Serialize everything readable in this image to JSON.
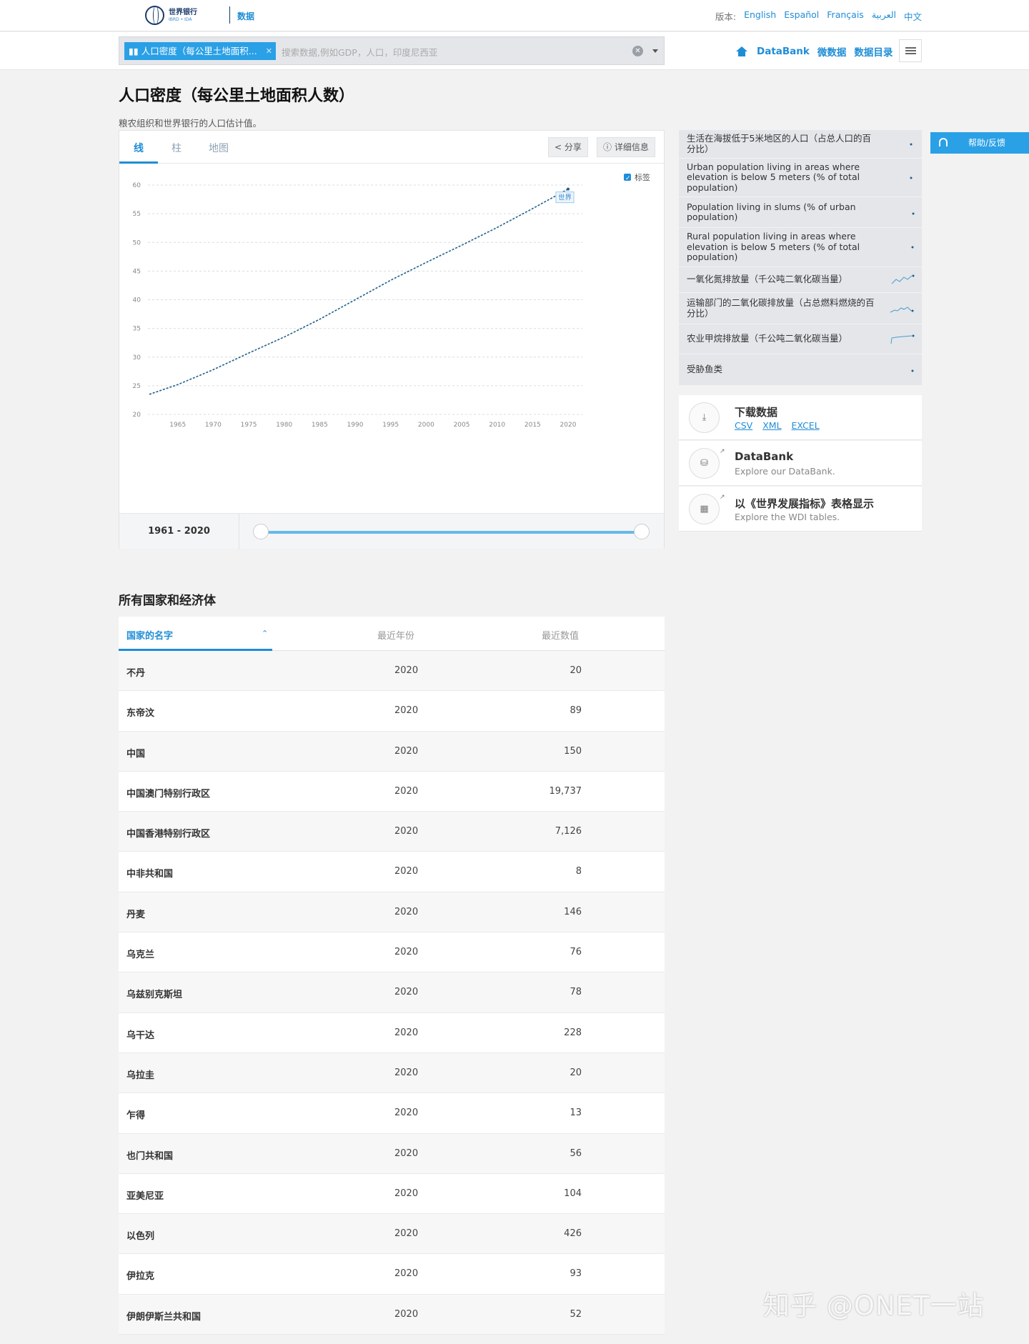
{
  "header": {
    "logo_line1": "世界银行",
    "logo_line2": "IBRD • IDA",
    "site_section": "数据",
    "lang_label": "版本:",
    "languages": [
      "English",
      "Español",
      "Français",
      "العربية",
      "中文"
    ]
  },
  "search": {
    "tag": "人口密度（每公里土地面积...",
    "placeholder": "搜索数据,例如GDP，人口，印度尼西亚"
  },
  "nav": {
    "items": [
      "DataBank",
      "微数据",
      "数据目录"
    ]
  },
  "page": {
    "title": "人口密度（每公里土地面积人数）",
    "subtitle": "粮农组织和世界银行的人口估计值。"
  },
  "chart_panel": {
    "tabs": [
      "线",
      "柱",
      "地图"
    ],
    "share_label": "分享",
    "details_label": "详细信息",
    "label_toggle": "标签",
    "range_label": "1961 - 2020"
  },
  "chart_data": {
    "type": "line",
    "title": "",
    "xlabel": "",
    "ylabel": "",
    "xlim": [
      1961,
      2020
    ],
    "ylim": [
      20,
      60
    ],
    "yticks": [
      20,
      25,
      30,
      35,
      40,
      45,
      50,
      55,
      60
    ],
    "xticks": [
      1965,
      1970,
      1975,
      1980,
      1985,
      1990,
      1995,
      2000,
      2005,
      2010,
      2015,
      2020
    ],
    "grid": true,
    "series": [
      {
        "name": "世界",
        "color": "#1f5f8b",
        "x": [
          1961,
          1965,
          1970,
          1975,
          1980,
          1985,
          1990,
          1995,
          2000,
          2005,
          2010,
          2015,
          2020
        ],
        "y": [
          23.5,
          25.2,
          27.8,
          30.7,
          33.5,
          36.6,
          40.0,
          43.4,
          46.5,
          49.5,
          52.6,
          55.9,
          59.3
        ]
      }
    ]
  },
  "related": [
    {
      "label": "生活在海拔低于5米地区的人口（占总人口的百分比）",
      "spark": "dot"
    },
    {
      "label": "Urban population living in areas where elevation is below 5 meters (% of total population)",
      "spark": "dot"
    },
    {
      "label": "Population living in slums (% of urban population)",
      "spark": "dot"
    },
    {
      "label": "Rural population living in areas where elevation is below 5 meters (% of total population)",
      "spark": "dot"
    },
    {
      "label": "一氧化氮排放量（千公吨二氧化碳当量）",
      "spark": "zigzag"
    },
    {
      "label": "运输部门的二氧化碳排放量（占总燃料燃烧的百分比）",
      "spark": "wave"
    },
    {
      "label": "农业甲烷排放量（千公吨二氧化碳当量）",
      "spark": "flat"
    },
    {
      "label": "受胁鱼类",
      "spark": "dot"
    }
  ],
  "download": {
    "title": "下载数据",
    "formats": [
      "CSV",
      "XML",
      "EXCEL"
    ]
  },
  "databank": {
    "title": "DataBank",
    "sub": "Explore our DataBank."
  },
  "wdi": {
    "title": "以《世界发展指标》表格显示",
    "sub": "Explore the WDI tables."
  },
  "help": {
    "label": "帮助/反馈"
  },
  "table": {
    "title": "所有国家和经济体",
    "headers": [
      "国家的名字",
      "最近年份",
      "最近数值"
    ],
    "rows": [
      {
        "name": "不丹",
        "year": "2020",
        "value": "20"
      },
      {
        "name": "东帝汶",
        "year": "2020",
        "value": "89"
      },
      {
        "name": "中国",
        "year": "2020",
        "value": "150"
      },
      {
        "name": "中国澳门特别行政区",
        "year": "2020",
        "value": "19,737"
      },
      {
        "name": "中国香港特别行政区",
        "year": "2020",
        "value": "7,126"
      },
      {
        "name": "中非共和国",
        "year": "2020",
        "value": "8"
      },
      {
        "name": "丹麦",
        "year": "2020",
        "value": "146"
      },
      {
        "name": "乌克兰",
        "year": "2020",
        "value": "76"
      },
      {
        "name": "乌兹别克斯坦",
        "year": "2020",
        "value": "78"
      },
      {
        "name": "乌干达",
        "year": "2020",
        "value": "228"
      },
      {
        "name": "乌拉圭",
        "year": "2020",
        "value": "20"
      },
      {
        "name": "乍得",
        "year": "2020",
        "value": "13"
      },
      {
        "name": "也门共和国",
        "year": "2020",
        "value": "56"
      },
      {
        "name": "亚美尼亚",
        "year": "2020",
        "value": "104"
      },
      {
        "name": "以色列",
        "year": "2020",
        "value": "426"
      },
      {
        "name": "伊拉克",
        "year": "2020",
        "value": "93"
      },
      {
        "name": "伊朗伊斯兰共和国",
        "year": "2020",
        "value": "52"
      }
    ]
  },
  "watermark": "知乎 @ONET一站"
}
